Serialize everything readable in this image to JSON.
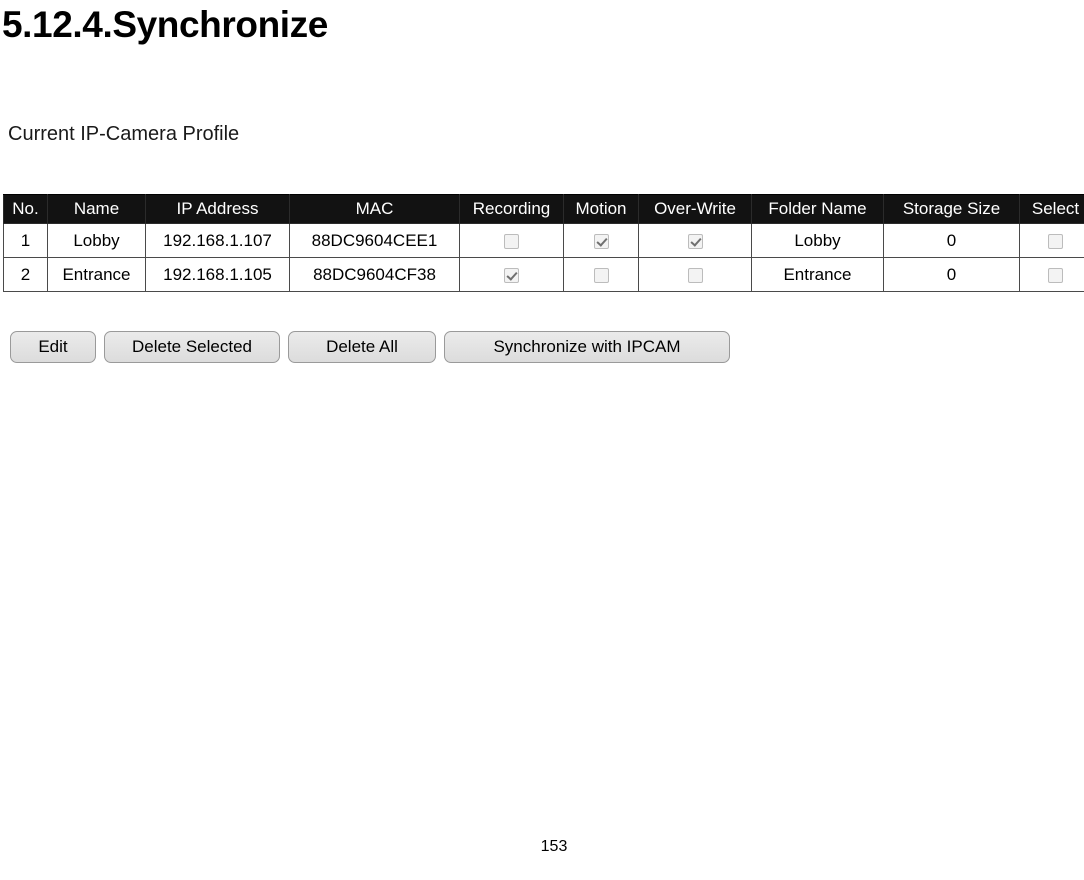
{
  "heading": "5.12.4.Synchronize",
  "subtitle": "Current IP-Camera Profile",
  "table": {
    "headers": {
      "no": "No.",
      "name": "Name",
      "ip": "IP Address",
      "mac": "MAC",
      "recording": "Recording",
      "motion": "Motion",
      "overwrite": "Over-Write",
      "folder": "Folder Name",
      "storage": "Storage Size",
      "select": "Select"
    },
    "rows": [
      {
        "no": "1",
        "name": "Lobby",
        "ip": "192.168.1.107",
        "mac": "88DC9604CEE1",
        "recording": false,
        "motion": true,
        "overwrite": true,
        "folder": "Lobby",
        "storage": "0",
        "select": false
      },
      {
        "no": "2",
        "name": "Entrance",
        "ip": "192.168.1.105",
        "mac": "88DC9604CF38",
        "recording": true,
        "motion": false,
        "overwrite": false,
        "folder": "Entrance",
        "storage": "0",
        "select": false
      }
    ]
  },
  "buttons": {
    "edit": "Edit",
    "delete_selected": "Delete Selected",
    "delete_all": "Delete All",
    "synchronize": "Synchronize with IPCAM"
  },
  "footer": {
    "page_number": "153"
  },
  "colors": {
    "header_background": "#121212",
    "header_text": "#ffffff",
    "body_background": "#ffffff",
    "button_face": "#e3e3e3",
    "checkbox_face": "#f3f3f3",
    "checkbox_tick": "#707070"
  }
}
